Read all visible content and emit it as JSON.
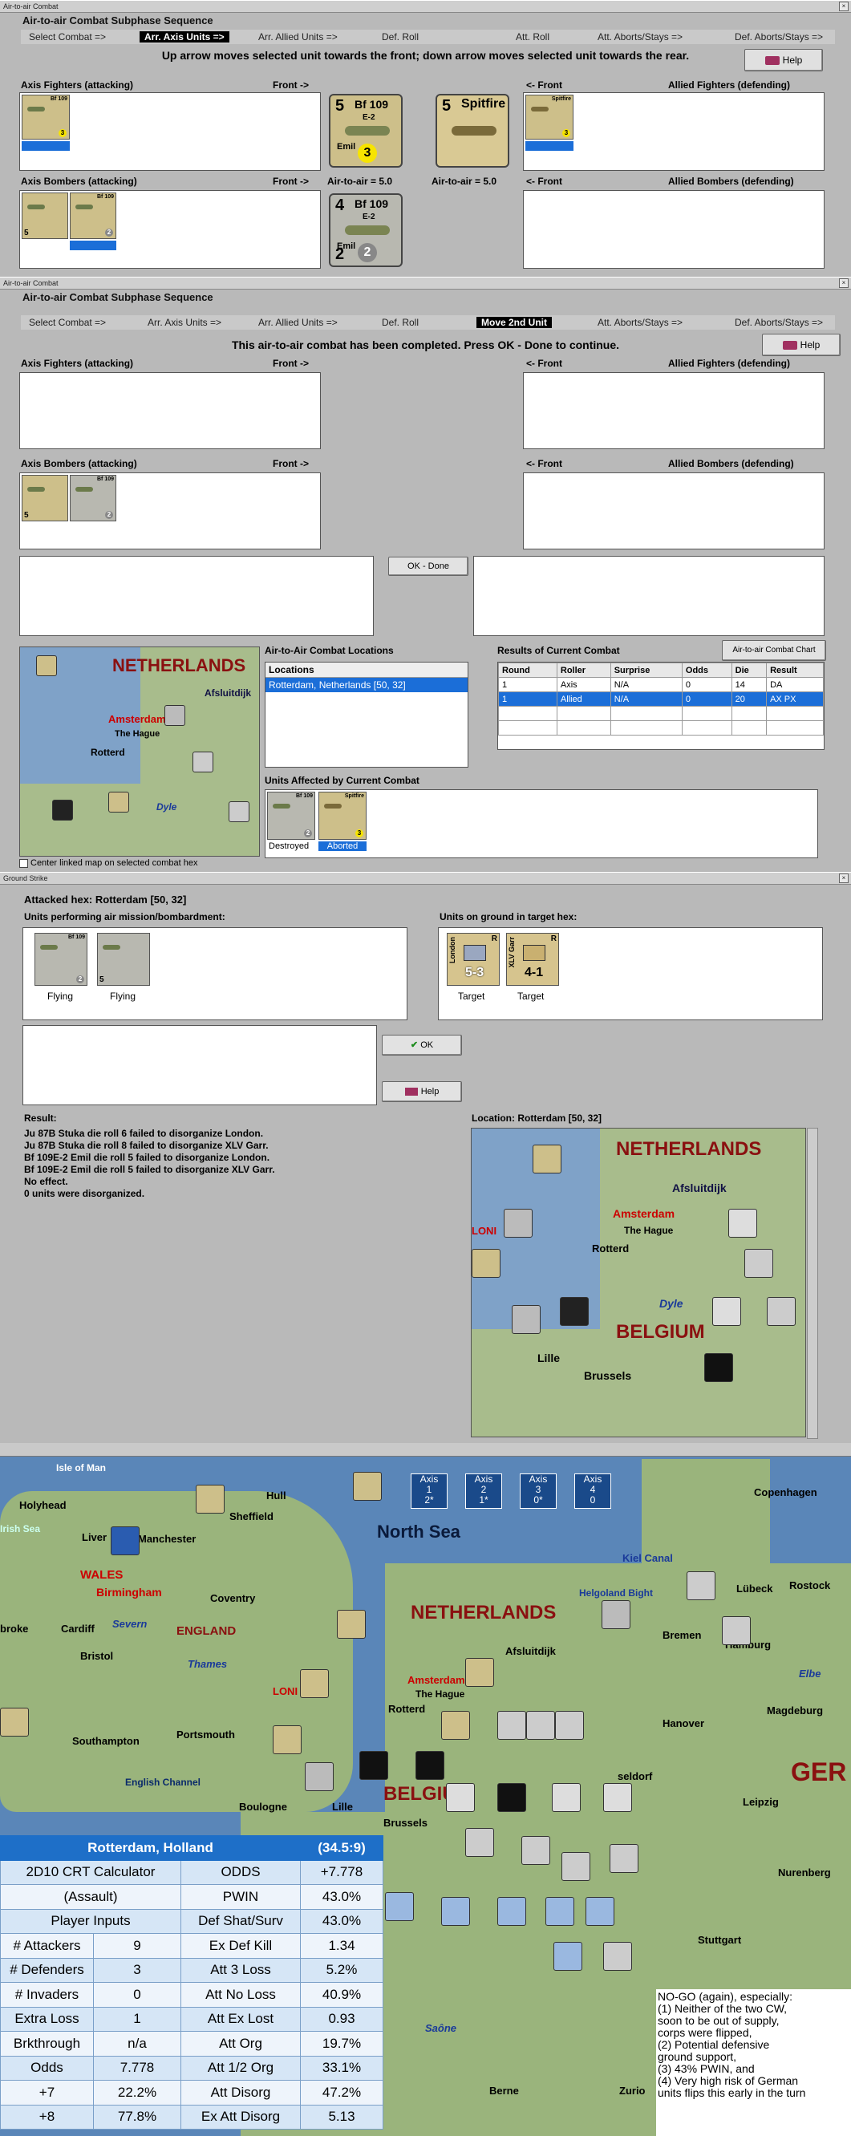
{
  "win1": {
    "title": "Air-to-air Combat",
    "subtitle": "Air-to-air Combat Subphase Sequence",
    "seq": [
      "Select Combat =>",
      "Arr. Axis Units =>",
      "Arr. Allied Units =>",
      "Def. Roll",
      "Att. Roll",
      "Att. Aborts/Stays =>",
      "Def. Aborts/Stays =>"
    ],
    "instruction": "Up arrow moves selected unit towards the front; down arrow moves selected unit towards the rear.",
    "help": "Help",
    "axis_fighters": "Axis Fighters (attacking)",
    "front_right": "Front ->",
    "front_left": "<- Front",
    "allied_fighters": "Allied Fighters (defending)",
    "axis_bombers": "Axis Bombers (attacking)",
    "allied_bombers": "Allied Bombers (defending)",
    "a2a_left": "Air-to-air = 5.0",
    "a2a_right": "Air-to-air = 5.0",
    "big_bf109": {
      "a": "5",
      "name": "Bf 109",
      "sub": "E-2",
      "pilot": "Emil",
      "val": "3"
    },
    "big_spitfire": {
      "a": "5",
      "name": "Spitfire"
    },
    "big_bf109b": {
      "a": "4",
      "name": "Bf 109",
      "sub": "E-2",
      "pilot": "Emil",
      "b": "2",
      "val": "2"
    }
  },
  "win2": {
    "title": "Air-to-air Combat",
    "subtitle": "Air-to-air Combat Subphase Sequence",
    "seq": [
      "Select Combat =>",
      "Arr. Axis Units =>",
      "Arr. Allied Units =>",
      "Def. Roll",
      "Move 2nd Unit",
      "Att. Aborts/Stays =>",
      "Def. Aborts/Stays =>"
    ],
    "instruction": "This air-to-air combat has been completed.  Press OK - Done to continue.",
    "help": "Help",
    "axis_fighters": "Axis Fighters (attacking)",
    "front_right": "Front ->",
    "front_left": "<- Front",
    "allied_fighters": "Allied Fighters (defending)",
    "axis_bombers": "Axis Bombers (attacking)",
    "allied_bombers": "Allied Bombers (defending)",
    "ok_done": "OK - Done",
    "locations_title": "Air-to-Air Combat Locations",
    "locations_header": "Locations",
    "location_row": "Rotterdam, Netherlands [50, 32]",
    "results_title": "Results of Current Combat",
    "chart_btn": "Air-to-air Combat Chart",
    "results_headers": [
      "Round",
      "Roller",
      "Surprise",
      "Odds",
      "Die",
      "Result"
    ],
    "results_rows": [
      [
        "1",
        "Axis",
        "N/A",
        "0",
        "14",
        "DA"
      ],
      [
        "1",
        "Allied",
        "N/A",
        "0",
        "20",
        "AX PX"
      ]
    ],
    "affected_title": "Units Affected by Current Combat",
    "destroyed": "Destroyed",
    "aborted": "Aborted",
    "center_map": "Center linked map on selected combat hex"
  },
  "win3": {
    "title": "Ground Strike",
    "attacked_hex": "Attacked hex: Rotterdam  [50, 32]",
    "units_air": "Units performing air mission/bombardment:",
    "units_ground": "Units on ground in target hex:",
    "flying1": "Flying",
    "flying2": "Flying",
    "target1": "Target",
    "target2": "Target",
    "ok": "OK",
    "help": "Help",
    "result_label": "Result:",
    "result_lines": [
      "Ju 87B Stuka die roll 6 failed to disorganize London.",
      "Ju 87B Stuka die roll 8 failed to disorganize XLV Garr.",
      "Bf 109E-2 Emil die roll 5 failed to disorganize London.",
      "Bf 109E-2 Emil die roll 5 failed to disorganize XLV Garr.",
      "No effect.",
      "0 units were disorganized."
    ],
    "location": "Location:  Rotterdam  [50, 32]",
    "unit_london": "London",
    "unit_london_val": "5-3",
    "unit_garr": "XLV Garr",
    "unit_garr_val": "4-1"
  },
  "map": {
    "labels": {
      "north_sea": "North Sea",
      "netherlands": "NETHERLANDS",
      "belgium": "BELGIUM",
      "england": "ENGLAND",
      "wales": "WALES",
      "irish_sea": "Irish Sea",
      "english_channel": "English Channel",
      "holyhead": "Holyhead",
      "liverpool": "Liver",
      "manchester": "Manchester",
      "sheffield": "Sheffield",
      "hull": "Hull",
      "birmingham": "Birmingham",
      "coventry": "Coventry",
      "cardiff": "Cardiff",
      "bristol": "Bristol",
      "severn": "Severn",
      "thames": "Thames",
      "southampton": "Southampton",
      "portsmouth": "Portsmouth",
      "boulogne": "Boulogne",
      "lille": "Lille",
      "brussels": "Brussels",
      "rotterdam": "Rotterd",
      "amsterdam": "Amsterdam",
      "the_hague": "The Hague",
      "afsluitdijk": "Afsluitdijk",
      "copenhagen": "Copenhagen",
      "kiel_canal": "Kiel Canal",
      "lubeck": "Lübeck",
      "rostock": "Rostock",
      "helgoland": "Helgoland Bight",
      "bremen": "Bremen",
      "hamburg": "Hamburg",
      "elbe": "Elbe",
      "hanover": "Hanover",
      "magdeburg": "Magdeburg",
      "leipzig": "Leipzig",
      "nurnberg": "Nurenberg",
      "stuttgart": "Stuttgart",
      "ger": "GER",
      "saone": "Saône",
      "berne": "Berne",
      "zurich": "Zurio",
      "isle_of_man": "Isle of Man",
      "dusseldorf": "seldorf",
      "london": "LONI",
      "dyle": "Dyle",
      "broke": "broke"
    },
    "axis_boxes": [
      {
        "label": "Axis",
        "num": "1",
        "val": "2*"
      },
      {
        "label": "Axis",
        "num": "2",
        "val": "1*"
      },
      {
        "label": "Axis",
        "num": "3",
        "val": "0*"
      },
      {
        "label": "Axis",
        "num": "4",
        "val": "0"
      }
    ]
  },
  "crt": {
    "title": "Rotterdam, Holland",
    "code": "(34.5:9)",
    "rows": [
      [
        "2D10 CRT Calculator",
        "ODDS",
        "+7.778"
      ],
      [
        "(Assault)",
        "PWIN",
        "43.0%"
      ],
      [
        "Player Inputs",
        "Def Shat/Surv",
        "43.0%"
      ],
      [
        "# Attackers",
        "9",
        "Ex Def Kill",
        "1.34"
      ],
      [
        "# Defenders",
        "3",
        "Att 3 Loss",
        "5.2%"
      ],
      [
        "# Invaders",
        "0",
        "Att No Loss",
        "40.9%"
      ],
      [
        "Extra Loss",
        "1",
        "Att Ex Lost",
        "0.93"
      ],
      [
        "Brkthrough",
        "n/a",
        "Att Org",
        "19.7%"
      ],
      [
        "Odds",
        "7.778",
        "Att 1/2 Org",
        "33.1%"
      ],
      [
        "+7",
        "22.2%",
        "Att Disorg",
        "47.2%"
      ],
      [
        "+8",
        "77.8%",
        "Ex Att Disorg",
        "5.13"
      ]
    ]
  },
  "note": {
    "lines": [
      "NO-GO (again), especially:",
      "(1) Neither of the two CW,",
      "soon to be out of supply,",
      "corps were flipped,",
      "(2)  Potential defensive",
      "ground support,",
      "(3)  43% PWIN, and",
      "(4)  Very high risk of German",
      "units flips this early in the turn"
    ]
  },
  "colors": {
    "accent": "#1b6ed8",
    "counter": "#cdbf8a",
    "crt_header": "#1e6fc8",
    "crt_light": "#d6e6f6",
    "selected": "#000000"
  }
}
